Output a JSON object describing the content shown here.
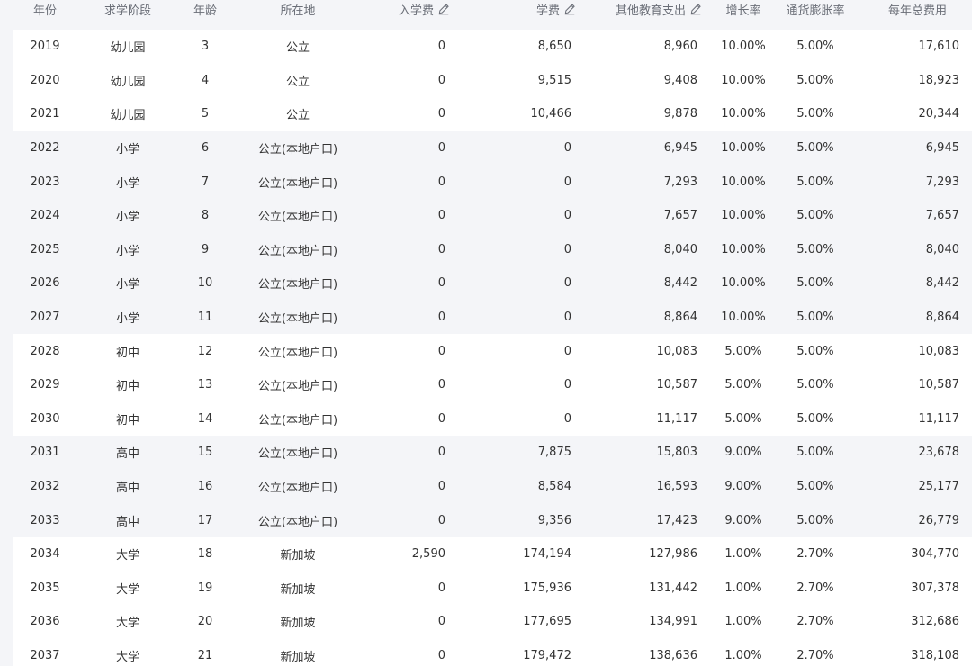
{
  "table": {
    "headers": {
      "year": "年份",
      "stage": "求学阶段",
      "age": "年龄",
      "location": "所在地",
      "entry_fee": "入学费",
      "tuition": "学费",
      "other": "其他教育支出",
      "growth": "增长率",
      "inflation": "通货膨胀率",
      "total": "每年总费用"
    },
    "rows": [
      {
        "year": "2019",
        "stage": "幼儿园",
        "age": "3",
        "location": "公立",
        "entry_fee": "0",
        "tuition": "8,650",
        "other": "8,960",
        "growth": "10.00%",
        "inflation": "5.00%",
        "total": "17,610",
        "group": "white"
      },
      {
        "year": "2020",
        "stage": "幼儿园",
        "age": "4",
        "location": "公立",
        "entry_fee": "0",
        "tuition": "9,515",
        "other": "9,408",
        "growth": "10.00%",
        "inflation": "5.00%",
        "total": "18,923",
        "group": "white"
      },
      {
        "year": "2021",
        "stage": "幼儿园",
        "age": "5",
        "location": "公立",
        "entry_fee": "0",
        "tuition": "10,466",
        "other": "9,878",
        "growth": "10.00%",
        "inflation": "5.00%",
        "total": "20,344",
        "group": "white"
      },
      {
        "year": "2022",
        "stage": "小学",
        "age": "6",
        "location": "公立(本地户口)",
        "entry_fee": "0",
        "tuition": "0",
        "other": "6,945",
        "growth": "10.00%",
        "inflation": "5.00%",
        "total": "6,945",
        "group": "gray"
      },
      {
        "year": "2023",
        "stage": "小学",
        "age": "7",
        "location": "公立(本地户口)",
        "entry_fee": "0",
        "tuition": "0",
        "other": "7,293",
        "growth": "10.00%",
        "inflation": "5.00%",
        "total": "7,293",
        "group": "gray"
      },
      {
        "year": "2024",
        "stage": "小学",
        "age": "8",
        "location": "公立(本地户口)",
        "entry_fee": "0",
        "tuition": "0",
        "other": "7,657",
        "growth": "10.00%",
        "inflation": "5.00%",
        "total": "7,657",
        "group": "gray"
      },
      {
        "year": "2025",
        "stage": "小学",
        "age": "9",
        "location": "公立(本地户口)",
        "entry_fee": "0",
        "tuition": "0",
        "other": "8,040",
        "growth": "10.00%",
        "inflation": "5.00%",
        "total": "8,040",
        "group": "gray"
      },
      {
        "year": "2026",
        "stage": "小学",
        "age": "10",
        "location": "公立(本地户口)",
        "entry_fee": "0",
        "tuition": "0",
        "other": "8,442",
        "growth": "10.00%",
        "inflation": "5.00%",
        "total": "8,442",
        "group": "gray"
      },
      {
        "year": "2027",
        "stage": "小学",
        "age": "11",
        "location": "公立(本地户口)",
        "entry_fee": "0",
        "tuition": "0",
        "other": "8,864",
        "growth": "10.00%",
        "inflation": "5.00%",
        "total": "8,864",
        "group": "gray"
      },
      {
        "year": "2028",
        "stage": "初中",
        "age": "12",
        "location": "公立(本地户口)",
        "entry_fee": "0",
        "tuition": "0",
        "other": "10,083",
        "growth": "5.00%",
        "inflation": "5.00%",
        "total": "10,083",
        "group": "white"
      },
      {
        "year": "2029",
        "stage": "初中",
        "age": "13",
        "location": "公立(本地户口)",
        "entry_fee": "0",
        "tuition": "0",
        "other": "10,587",
        "growth": "5.00%",
        "inflation": "5.00%",
        "total": "10,587",
        "group": "white"
      },
      {
        "year": "2030",
        "stage": "初中",
        "age": "14",
        "location": "公立(本地户口)",
        "entry_fee": "0",
        "tuition": "0",
        "other": "11,117",
        "growth": "5.00%",
        "inflation": "5.00%",
        "total": "11,117",
        "group": "white"
      },
      {
        "year": "2031",
        "stage": "高中",
        "age": "15",
        "location": "公立(本地户口)",
        "entry_fee": "0",
        "tuition": "7,875",
        "other": "15,803",
        "growth": "9.00%",
        "inflation": "5.00%",
        "total": "23,678",
        "group": "gray"
      },
      {
        "year": "2032",
        "stage": "高中",
        "age": "16",
        "location": "公立(本地户口)",
        "entry_fee": "0",
        "tuition": "8,584",
        "other": "16,593",
        "growth": "9.00%",
        "inflation": "5.00%",
        "total": "25,177",
        "group": "gray"
      },
      {
        "year": "2033",
        "stage": "高中",
        "age": "17",
        "location": "公立(本地户口)",
        "entry_fee": "0",
        "tuition": "9,356",
        "other": "17,423",
        "growth": "9.00%",
        "inflation": "5.00%",
        "total": "26,779",
        "group": "gray"
      },
      {
        "year": "2034",
        "stage": "大学",
        "age": "18",
        "location": "新加坡",
        "entry_fee": "2,590",
        "tuition": "174,194",
        "other": "127,986",
        "growth": "1.00%",
        "inflation": "2.70%",
        "total": "304,770",
        "group": "white"
      },
      {
        "year": "2035",
        "stage": "大学",
        "age": "19",
        "location": "新加坡",
        "entry_fee": "0",
        "tuition": "175,936",
        "other": "131,442",
        "growth": "1.00%",
        "inflation": "2.70%",
        "total": "307,378",
        "group": "white"
      },
      {
        "year": "2036",
        "stage": "大学",
        "age": "20",
        "location": "新加坡",
        "entry_fee": "0",
        "tuition": "177,695",
        "other": "134,991",
        "growth": "1.00%",
        "inflation": "2.70%",
        "total": "312,686",
        "group": "white"
      },
      {
        "year": "2037",
        "stage": "大学",
        "age": "21",
        "location": "新加坡",
        "entry_fee": "0",
        "tuition": "179,472",
        "other": "138,636",
        "growth": "1.00%",
        "inflation": "2.70%",
        "total": "318,108",
        "group": "white"
      }
    ]
  },
  "icons": {
    "edit": "pencil-edit-icon"
  }
}
